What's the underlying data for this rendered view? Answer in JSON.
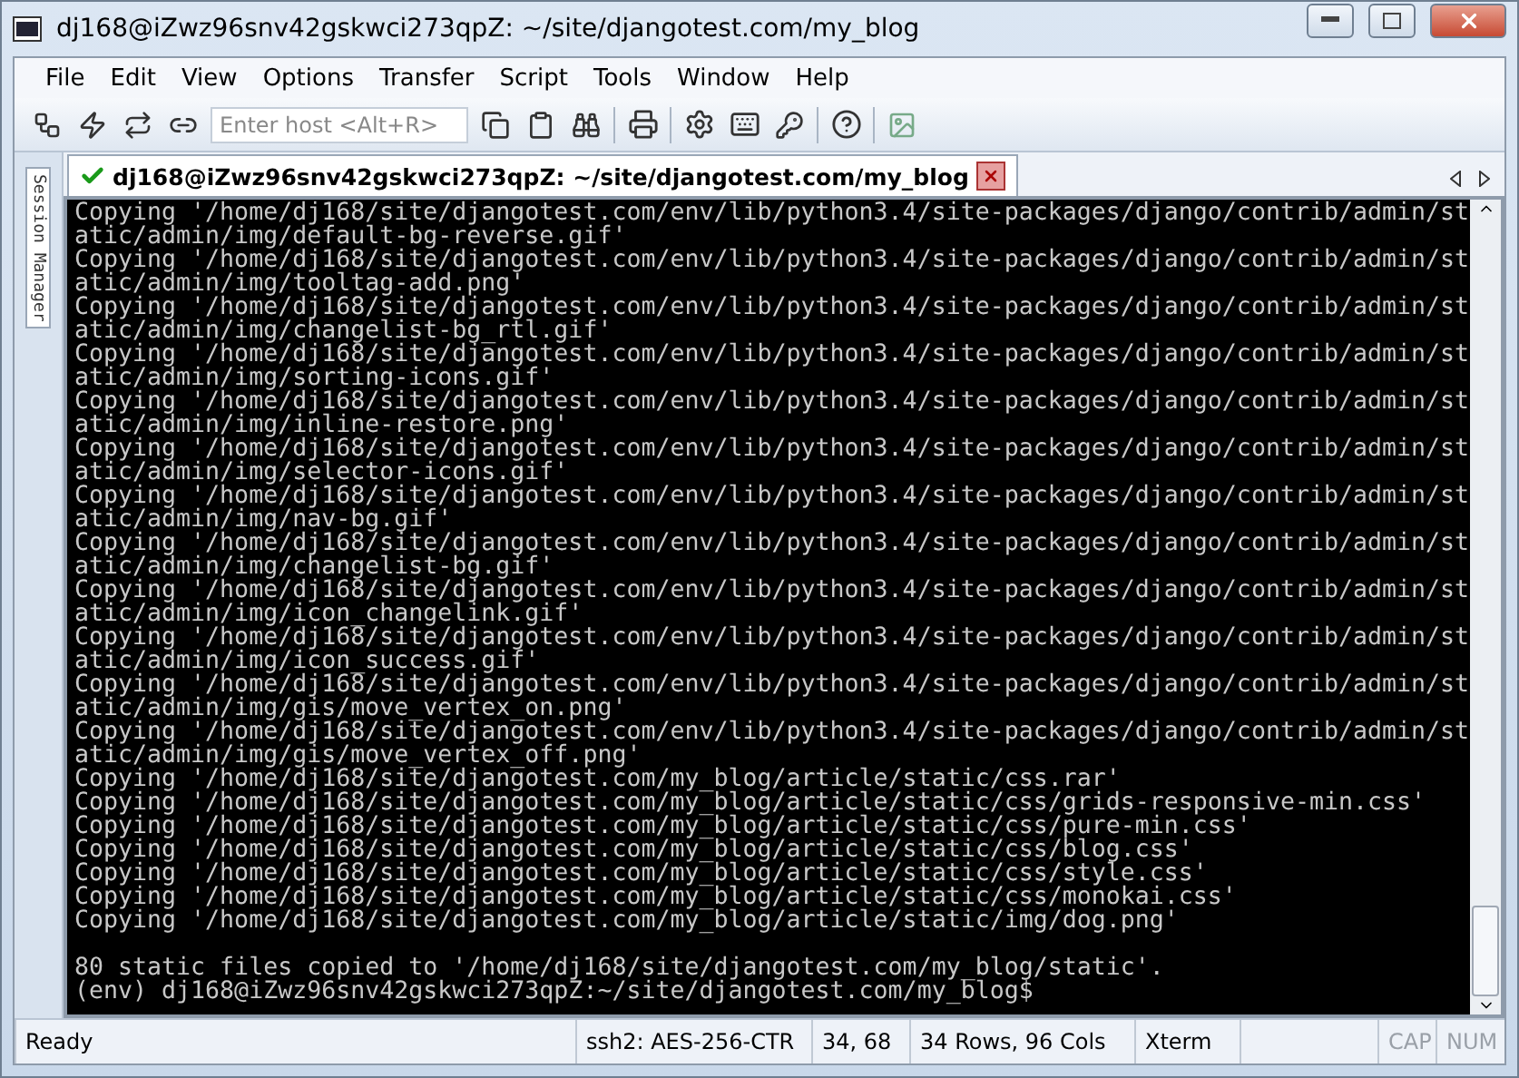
{
  "window": {
    "title": "dj168@iZwz96snv42gskwci273qpZ: ~/site/djangotest.com/my_blog"
  },
  "menu": [
    "File",
    "Edit",
    "View",
    "Options",
    "Transfer",
    "Script",
    "Tools",
    "Window",
    "Help"
  ],
  "toolbar": {
    "host_field": {
      "placeholder": "Enter host <Alt+R>"
    }
  },
  "session_manager": {
    "label": "Session Manager"
  },
  "tabs": [
    {
      "label": "dj168@iZwz96snv42gskwci273qpZ: ~/site/djangotest.com/my_blog",
      "selected": true,
      "connected": true
    }
  ],
  "terminal": {
    "lines": [
      "Copying '/home/dj168/site/djangotest.com/env/lib/python3.4/site-packages/django/contrib/admin/st",
      "atic/admin/img/default-bg-reverse.gif'",
      "Copying '/home/dj168/site/djangotest.com/env/lib/python3.4/site-packages/django/contrib/admin/st",
      "atic/admin/img/tooltag-add.png'",
      "Copying '/home/dj168/site/djangotest.com/env/lib/python3.4/site-packages/django/contrib/admin/st",
      "atic/admin/img/changelist-bg_rtl.gif'",
      "Copying '/home/dj168/site/djangotest.com/env/lib/python3.4/site-packages/django/contrib/admin/st",
      "atic/admin/img/sorting-icons.gif'",
      "Copying '/home/dj168/site/djangotest.com/env/lib/python3.4/site-packages/django/contrib/admin/st",
      "atic/admin/img/inline-restore.png'",
      "Copying '/home/dj168/site/djangotest.com/env/lib/python3.4/site-packages/django/contrib/admin/st",
      "atic/admin/img/selector-icons.gif'",
      "Copying '/home/dj168/site/djangotest.com/env/lib/python3.4/site-packages/django/contrib/admin/st",
      "atic/admin/img/nav-bg.gif'",
      "Copying '/home/dj168/site/djangotest.com/env/lib/python3.4/site-packages/django/contrib/admin/st",
      "atic/admin/img/changelist-bg.gif'",
      "Copying '/home/dj168/site/djangotest.com/env/lib/python3.4/site-packages/django/contrib/admin/st",
      "atic/admin/img/icon_changelink.gif'",
      "Copying '/home/dj168/site/djangotest.com/env/lib/python3.4/site-packages/django/contrib/admin/st",
      "atic/admin/img/icon_success.gif'",
      "Copying '/home/dj168/site/djangotest.com/env/lib/python3.4/site-packages/django/contrib/admin/st",
      "atic/admin/img/gis/move_vertex_on.png'",
      "Copying '/home/dj168/site/djangotest.com/env/lib/python3.4/site-packages/django/contrib/admin/st",
      "atic/admin/img/gis/move_vertex_off.png'",
      "Copying '/home/dj168/site/djangotest.com/my_blog/article/static/css.rar'",
      "Copying '/home/dj168/site/djangotest.com/my_blog/article/static/css/grids-responsive-min.css'",
      "Copying '/home/dj168/site/djangotest.com/my_blog/article/static/css/pure-min.css'",
      "Copying '/home/dj168/site/djangotest.com/my_blog/article/static/css/blog.css'",
      "Copying '/home/dj168/site/djangotest.com/my_blog/article/static/css/style.css'",
      "Copying '/home/dj168/site/djangotest.com/my_blog/article/static/css/monokai.css'",
      "Copying '/home/dj168/site/djangotest.com/my_blog/article/static/img/dog.png'"
    ],
    "summary_lines": [
      "80 static files copied to '/home/dj168/site/djangotest.com/my_blog/static'.",
      "(env) dj168@iZwz96snv42gskwci273qpZ:~/site/djangotest.com/my_blog$"
    ]
  },
  "status_bar": [
    {
      "kind": "text",
      "text": "Ready"
    },
    {
      "kind": "text",
      "text": "ssh2: AES-256-CTR"
    },
    {
      "kind": "text",
      "text": "34,  68"
    },
    {
      "kind": "text",
      "text": "34 Rows, 96 Cols"
    },
    {
      "kind": "text",
      "text": "Xterm"
    },
    {
      "kind": "blank"
    },
    {
      "kind": "indicator",
      "text": "CAP",
      "on": false
    },
    {
      "kind": "indicator",
      "text": "NUM",
      "on": false
    }
  ]
}
